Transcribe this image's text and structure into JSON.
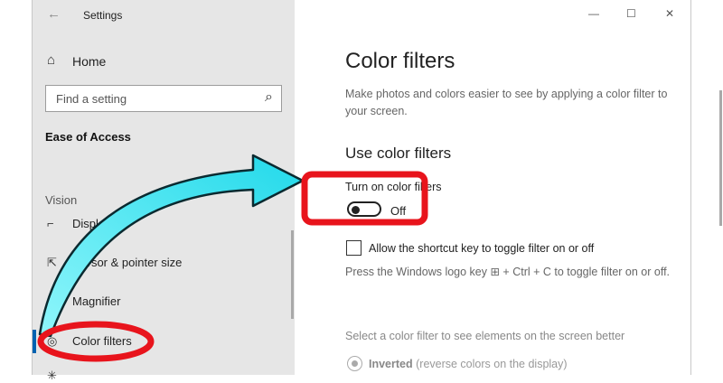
{
  "window": {
    "title": "Settings",
    "back_glyph": "←",
    "minimize_glyph": "—",
    "maximize_glyph": "☐",
    "close_glyph": "✕"
  },
  "sidebar": {
    "home_label": "Home",
    "search_placeholder": "Find a setting",
    "section_title": "Ease of Access",
    "group_label": "Vision",
    "items": [
      {
        "icon": "display-icon",
        "glyph": "⌐",
        "label": "Display"
      },
      {
        "icon": "cursor-icon",
        "glyph": "⇱",
        "label": "Cursor & pointer size"
      },
      {
        "icon": "magnifier-icon",
        "glyph": "⌕",
        "label": "Magnifier"
      },
      {
        "icon": "color-filters-icon",
        "glyph": "◎",
        "label": "Color filters"
      }
    ],
    "selected_index": 3
  },
  "main": {
    "page_title": "Color filters",
    "description": "Make photos and colors easier to see by applying a color filter to your screen.",
    "sub_heading": "Use color filters",
    "toggle_label": "Turn on color filters",
    "toggle_state": "Off",
    "toggle_on": false,
    "shortcut_checkbox_label": "Allow the shortcut key to toggle filter on or off",
    "shortcut_checked": false,
    "shortcut_hint": "Press the Windows logo key ⊞ + Ctrl + C to toggle filter on or off.",
    "select_filter_label": "Select a color filter to see elements on the screen better",
    "radio_option_name": "Inverted",
    "radio_option_desc": " (reverse colors on the display)"
  },
  "annotation": {
    "highlight_color": "#e8141c",
    "arrow_color": "#2fe0ef"
  }
}
